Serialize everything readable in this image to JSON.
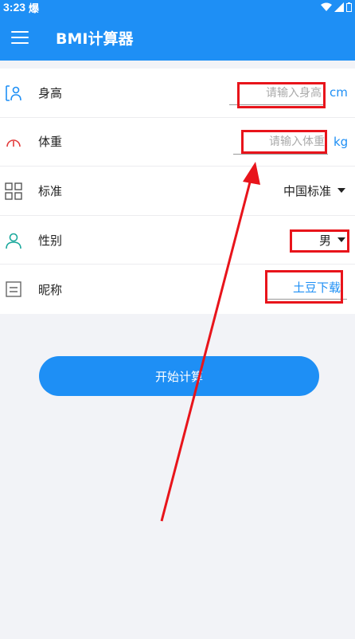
{
  "status_bar": {
    "time": "3:23",
    "carrier": "爆"
  },
  "app_bar": {
    "title": "BMI计算器",
    "menu_icon": "hamburger-menu-icon"
  },
  "form": {
    "height": {
      "label": "身高",
      "placeholder": "请输入身高",
      "value": "",
      "unit": "cm",
      "icon": "person-height-icon"
    },
    "weight": {
      "label": "体重",
      "placeholder": "请输入体重",
      "value": "",
      "unit": "kg",
      "icon": "gauge-icon"
    },
    "standard": {
      "label": "标准",
      "selected": "中国标准",
      "icon": "grid-icon"
    },
    "gender": {
      "label": "性别",
      "selected": "男",
      "icon": "user-icon"
    },
    "nickname": {
      "label": "昵称",
      "value": "土豆下载",
      "icon": "document-icon"
    }
  },
  "actions": {
    "start_label": "开始计算"
  },
  "colors": {
    "accent": "#1e8ff5",
    "annotation": "#e8141b",
    "teal": "#1aa89c",
    "weight_icon": "#e23b3b"
  }
}
